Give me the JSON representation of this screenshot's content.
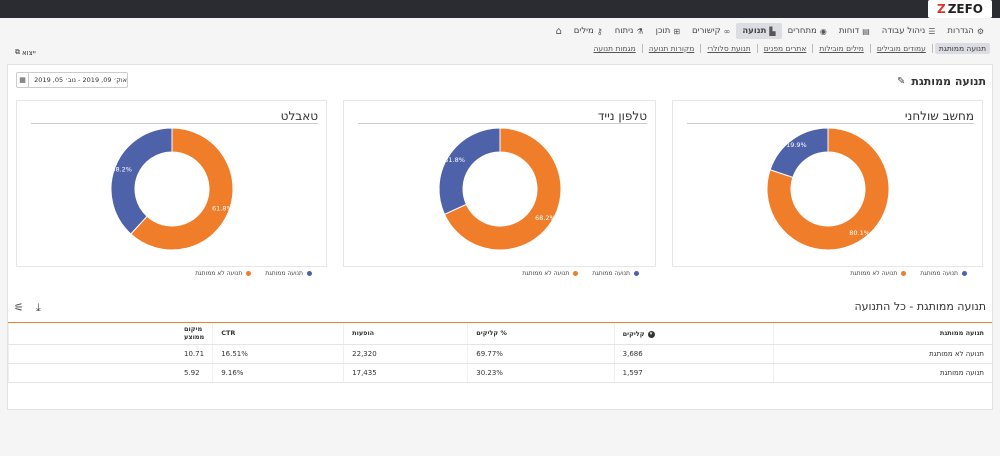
{
  "brand": {
    "name": "ZEFO",
    "mark": "Z"
  },
  "nav": {
    "items": [
      {
        "key": "keywords",
        "label": "מילים",
        "icon": "key-icon"
      },
      {
        "key": "analysis",
        "label": "ניתוח",
        "icon": "flask-icon"
      },
      {
        "key": "content",
        "label": "תוכן",
        "icon": "sitemap-icon"
      },
      {
        "key": "links",
        "label": "קישורים",
        "icon": "link-icon"
      },
      {
        "key": "traffic",
        "label": "תנועה",
        "icon": "bar-chart-icon",
        "active": true
      },
      {
        "key": "competitors",
        "label": "מתחרים",
        "icon": "eye-icon"
      },
      {
        "key": "reports",
        "label": "דוחות",
        "icon": "report-icon"
      },
      {
        "key": "workflow",
        "label": "ניהול עבודה",
        "icon": "list-icon"
      },
      {
        "key": "settings",
        "label": "הגדרות",
        "icon": "gear-icon"
      }
    ]
  },
  "subnav": {
    "items": [
      {
        "label": "תנועה ממותגת",
        "active": true
      },
      {
        "label": "עמודים מובילים"
      },
      {
        "label": "מילים מובילות"
      },
      {
        "label": "אתרים מפנים"
      },
      {
        "label": "תנועת סלולרי"
      },
      {
        "label": "מקורות תנועה"
      },
      {
        "label": "מגמות תנועה"
      }
    ]
  },
  "export_label": "ייצוא",
  "section_title": "תנועה ממותגת",
  "date_range": "אוק׳ 09, 2019 - נוב׳ 05, 2019",
  "chart_data": [
    {
      "type": "pie",
      "title": "מחשב שולחני",
      "series": [
        {
          "name": "תנועה ממותגת",
          "value": 19.9,
          "color": "#4e62aa"
        },
        {
          "name": "תנועה לא ממותגת",
          "value": 80.1,
          "color": "#ef7d2a"
        }
      ]
    },
    {
      "type": "pie",
      "title": "טלפון נייד",
      "series": [
        {
          "name": "תנועה ממותגת",
          "value": 31.8,
          "color": "#4e62aa"
        },
        {
          "name": "תנועה לא ממותגת",
          "value": 68.2,
          "color": "#ef7d2a"
        }
      ]
    },
    {
      "type": "pie",
      "title": "טאבלט",
      "series": [
        {
          "name": "תנועה ממותגת",
          "value": 38.2,
          "color": "#4e62aa"
        },
        {
          "name": "תנועה לא ממותגת",
          "value": 61.8,
          "color": "#ef7d2a"
        }
      ]
    }
  ],
  "table": {
    "title": "תנועה ממותגת - כל התנועה",
    "columns": [
      "תנועה ממותגת",
      "קליקים",
      "% קליקים",
      "הופעות",
      "CTR",
      "מיקום ממוצע"
    ],
    "rows": [
      [
        "תנועה לא ממותגת",
        "3,686",
        "69.77%",
        "22,320",
        "16.51%",
        "10.71"
      ],
      [
        "תנועה ממותגת",
        "1,597",
        "30.23%",
        "17,435",
        "9.16%",
        "5.92"
      ]
    ]
  }
}
